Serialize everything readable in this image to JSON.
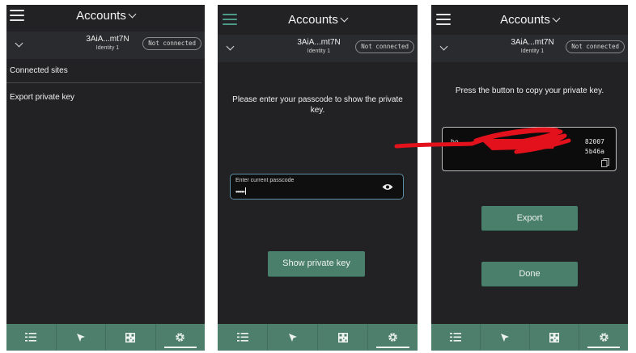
{
  "header": {
    "title": "Accounts"
  },
  "identity": {
    "name": "3AiA...mt7N",
    "label": "Identity 1",
    "status": "Not connected"
  },
  "screen1": {
    "menu": [
      "Connected sites",
      "Export private key"
    ]
  },
  "screen2": {
    "prompt": "Please enter your passcode to show the private key.",
    "passcode_label": "Enter current passcode",
    "passcode_value": "••••••",
    "show_button": "Show private key"
  },
  "screen3": {
    "prompt": "Press the button to copy your private key.",
    "key_line1_prefix": "bo",
    "key_line1_suffix": "82007",
    "key_line2_suffix": "5b46a",
    "export_button": "Export",
    "done_button": "Done"
  },
  "nav": {
    "icons": [
      "list-icon",
      "cursor-arrow-icon",
      "qr-code-icon",
      "settings-gear-icon"
    ],
    "active": "settings-gear-icon"
  },
  "colors": {
    "accent": "#4d7f6c",
    "background": "#222224",
    "redaction": "#e3111b"
  }
}
